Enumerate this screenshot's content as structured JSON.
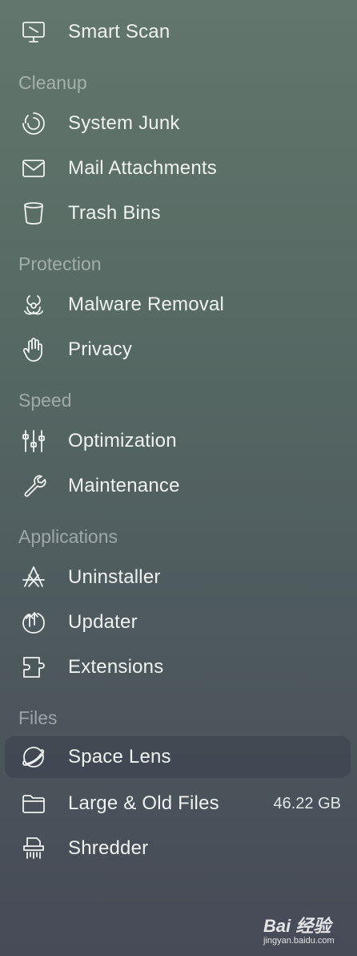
{
  "top": {
    "smart_scan": {
      "label": "Smart Scan",
      "icon": "monitor-icon"
    }
  },
  "sections": {
    "cleanup": {
      "header": "Cleanup",
      "items": [
        {
          "label": "System Junk",
          "icon": "system-junk-icon"
        },
        {
          "label": "Mail Attachments",
          "icon": "envelope-icon"
        },
        {
          "label": "Trash Bins",
          "icon": "trash-bin-icon"
        }
      ]
    },
    "protection": {
      "header": "Protection",
      "items": [
        {
          "label": "Malware Removal",
          "icon": "biohazard-icon"
        },
        {
          "label": "Privacy",
          "icon": "hand-icon"
        }
      ]
    },
    "speed": {
      "header": "Speed",
      "items": [
        {
          "label": "Optimization",
          "icon": "sliders-icon"
        },
        {
          "label": "Maintenance",
          "icon": "wrench-icon"
        }
      ]
    },
    "applications": {
      "header": "Applications",
      "items": [
        {
          "label": "Uninstaller",
          "icon": "uninstaller-icon"
        },
        {
          "label": "Updater",
          "icon": "updater-icon"
        },
        {
          "label": "Extensions",
          "icon": "puzzle-icon"
        }
      ]
    },
    "files": {
      "header": "Files",
      "items": [
        {
          "label": "Space Lens",
          "icon": "planet-icon",
          "active": true
        },
        {
          "label": "Large & Old Files",
          "icon": "folder-icon",
          "size": "46.22 GB"
        },
        {
          "label": "Shredder",
          "icon": "shredder-icon"
        }
      ]
    }
  },
  "watermark": {
    "main": "Bai 经验",
    "sub": "jingyan.baidu.com"
  }
}
